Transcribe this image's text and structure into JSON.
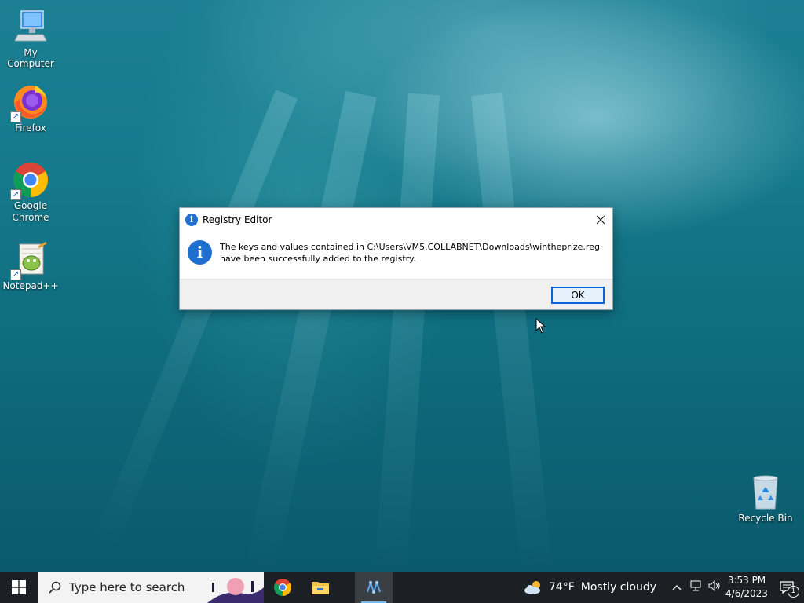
{
  "desktop": {
    "icons": [
      {
        "label": "My Computer",
        "icon": "computer-icon"
      },
      {
        "label": "Firefox",
        "icon": "firefox-icon"
      },
      {
        "label": "Google Chrome",
        "icon": "chrome-icon"
      },
      {
        "label": "Notepad++",
        "icon": "notepadpp-icon"
      },
      {
        "label": "Recycle Bin",
        "icon": "recycle-bin-icon"
      }
    ]
  },
  "dialog": {
    "title": "Registry Editor",
    "message_line1": "The keys and values contained in C:\\Users\\VM5.COLLABNET\\Downloads\\wintheprize.reg",
    "message_line2": "have been successfully added to the registry.",
    "ok_label": "OK",
    "icon": "info-icon"
  },
  "taskbar": {
    "search_placeholder": "Type here to search",
    "apps": [
      "chrome-icon",
      "file-explorer-icon",
      "registry-editor-icon"
    ],
    "weather_temp": "74°F",
    "weather_text": "Mostly cloudy",
    "time": "3:53 PM",
    "date": "4/6/2023",
    "notification_count": "1"
  },
  "colors": {
    "accent": "#0a64d8",
    "taskbar": "#1c2024",
    "info_blue": "#1e6fd0"
  }
}
